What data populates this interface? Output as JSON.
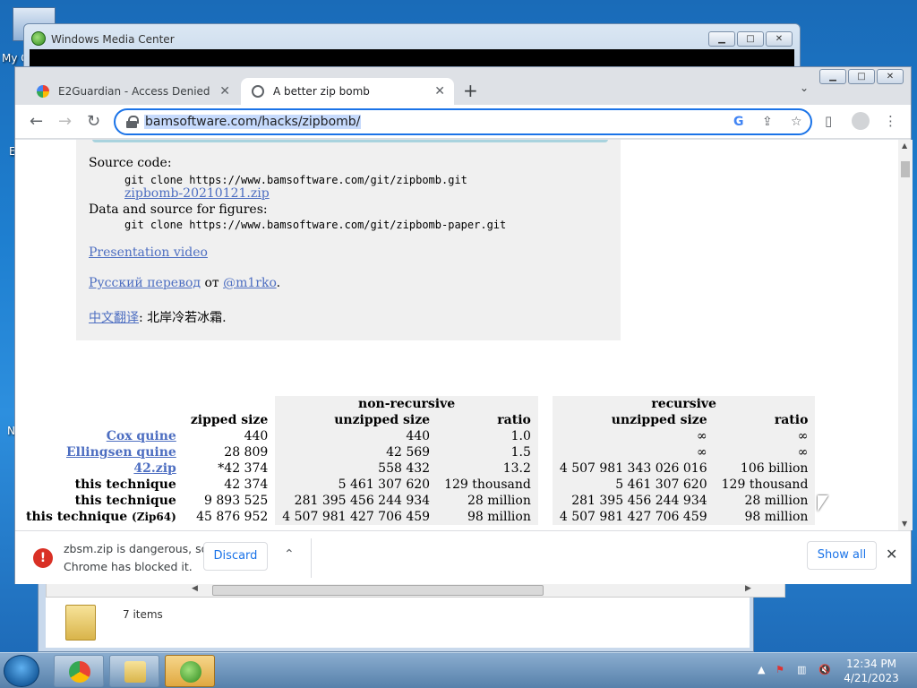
{
  "desktop": {
    "icon_label_partial_1": "My C",
    "icon_label_partial_2": "E",
    "icon_label_partial_3": "N"
  },
  "wmc": {
    "title": "Windows Media Center"
  },
  "explorer": {
    "status": "7 items"
  },
  "chrome": {
    "tabs": [
      {
        "title": "E2Guardian - Access Denied",
        "favicon": "google-icon"
      },
      {
        "title": "A better zip bomb",
        "favicon": "globe-icon",
        "active": true
      }
    ],
    "new_tab": "+",
    "url": "bamsoftware.com/hacks/zipbomb/"
  },
  "page": {
    "source_code_label": "Source code:",
    "git_clone_1": "git clone https://www.bamsoftware.com/git/zipbomb.git",
    "zip_link": "zipbomb-20210121.zip",
    "data_source_label": "Data and source for figures:",
    "git_clone_2": "git clone https://www.bamsoftware.com/git/zipbomb-paper.git",
    "presentation_link": "Presentation video",
    "russian_link": "Русский перевод",
    "russian_ot": "от",
    "russian_author_link": "@m1rko",
    "russian_period": ".",
    "chinese_link": "中文翻译",
    "chinese_rest": ": 北岸冷若冰霜."
  },
  "table": {
    "group_nonrecursive": "non-recursive",
    "group_recursive": "recursive",
    "col_zipped": "zipped size",
    "col_unzipped": "unzipped size",
    "col_ratio": "ratio",
    "rows": [
      {
        "name": "Cox quine",
        "link": true,
        "zipped": "440",
        "nr_unzipped": "440",
        "nr_ratio": "1.0",
        "r_unzipped": "∞",
        "r_ratio": "∞"
      },
      {
        "name": "Ellingsen quine",
        "link": true,
        "zipped": "28 809",
        "nr_unzipped": "42 569",
        "nr_ratio": "1.5",
        "r_unzipped": "∞",
        "r_ratio": "∞"
      },
      {
        "name": "42.zip",
        "link": true,
        "zipped": "*42 374",
        "nr_unzipped": "558 432",
        "nr_ratio": "13.2",
        "r_unzipped": "4 507 981 343 026 016",
        "r_ratio": "106 billion"
      },
      {
        "name": "this technique",
        "link": false,
        "zipped": "42 374",
        "nr_unzipped": "5 461 307 620",
        "nr_ratio": "129 thousand",
        "r_unzipped": "5 461 307 620",
        "r_ratio": "129 thousand"
      },
      {
        "name": "this technique",
        "link": false,
        "zipped": "9 893 525",
        "nr_unzipped": "281 395 456 244 934",
        "nr_ratio": "28 million",
        "r_unzipped": "281 395 456 244 934",
        "r_ratio": "28 million"
      },
      {
        "name": "this technique",
        "suffix": "(Zip64)",
        "link": false,
        "zipped": "45 876 952",
        "nr_unzipped": "4 507 981 427 706 459",
        "nr_ratio": "98 million",
        "r_unzipped": "4 507 981 427 706 459",
        "r_ratio": "98 million"
      }
    ]
  },
  "download": {
    "line1": "zbsm.zip is dangerous, so",
    "line2": "Chrome has blocked it.",
    "discard": "Discard",
    "show_all": "Show all"
  },
  "taskbar": {
    "time": "12:34 PM",
    "date": "4/21/2023"
  }
}
